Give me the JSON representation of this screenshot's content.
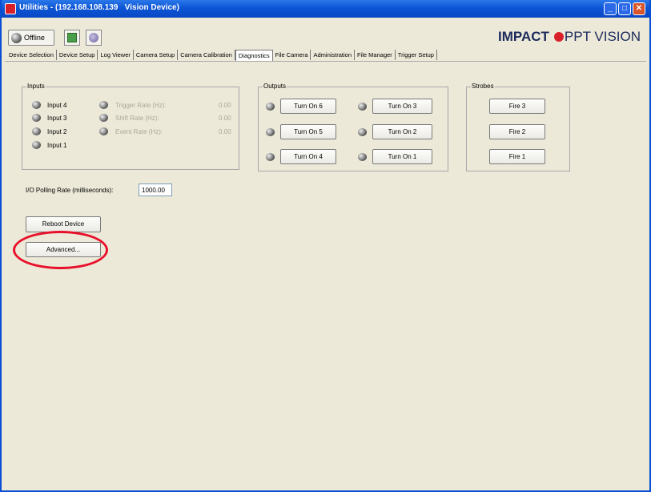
{
  "window": {
    "title": "Utilities - (192.168.108.139   Vision Device)",
    "min": "_",
    "max": "□",
    "close": "✕"
  },
  "toolbar": {
    "offline_label": "Offline",
    "brand_impact": "IMPACT",
    "brand_ppt": "PPT VISION"
  },
  "tabs": [
    "Device Selection",
    "Device Setup",
    "Log Viewer",
    "Camera Setup",
    "Camera Calibration",
    "Diagnostics",
    "File Camera",
    "Administration",
    "File Manager",
    "Trigger Setup"
  ],
  "inputs": {
    "legend": "Inputs",
    "items": [
      "Input 4",
      "Input 3",
      "Input 2",
      "Input 1"
    ],
    "rates": [
      {
        "label": "Trigger Rate (Hz):",
        "value": "0.00"
      },
      {
        "label": "Shift Rate (Hz):",
        "value": "0.00"
      },
      {
        "label": "Event Rate (Hz):",
        "value": "0.00"
      }
    ]
  },
  "outputs": {
    "legend": "Outputs",
    "buttons": [
      "Turn On 6",
      "Turn On 3",
      "Turn On 5",
      "Turn On 2",
      "Turn On 4",
      "Turn On 1"
    ]
  },
  "strobes": {
    "legend": "Strobes",
    "buttons": [
      "Fire 3",
      "Fire 2",
      "Fire 1"
    ]
  },
  "polling": {
    "label": "I/O Polling Rate (milliseconds):",
    "value": "1000.00"
  },
  "actions": {
    "reboot": "Reboot Device",
    "advanced": "Advanced..."
  }
}
